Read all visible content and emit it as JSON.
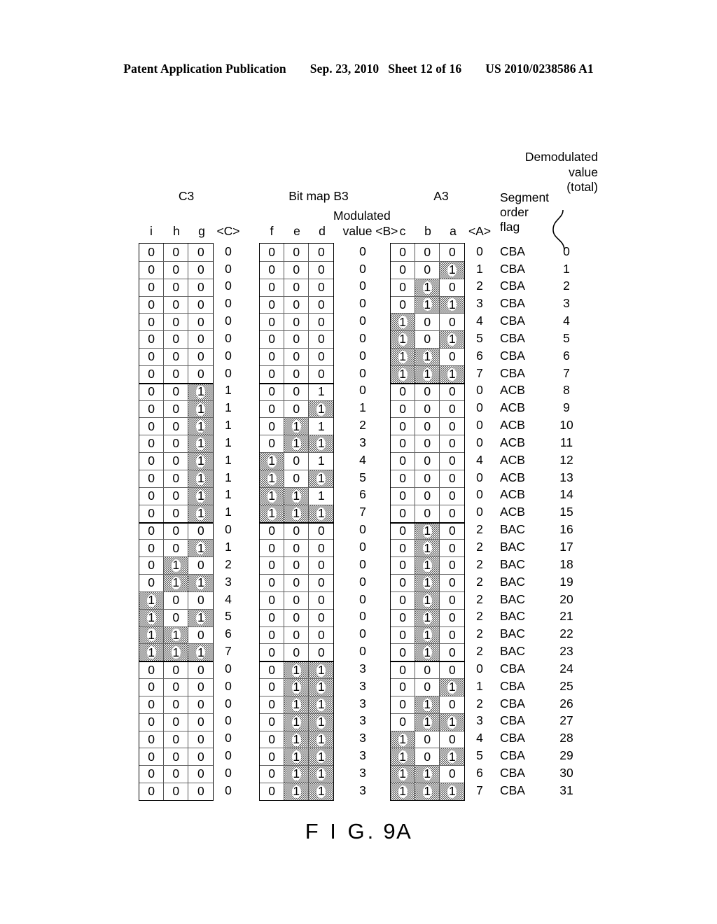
{
  "patent_header": {
    "publication": "Patent Application Publication",
    "date": "Sep. 23, 2010",
    "sheet": "Sheet 12 of 16",
    "number": "US 2010/0238586 A1"
  },
  "figure": {
    "caption_prefix": "F I G.",
    "caption_number": "9A",
    "labels": {
      "c3": "C3",
      "bitmap_b3": "Bit map B3",
      "a3": "A3",
      "modulated_value": "Modulated\nvalue <B>",
      "modulated_line1": "Modulated",
      "segment_order_flag": "Segment\norder\nflag",
      "segment_line1": "Segment",
      "segment_line2": "order",
      "segment_line3": "flag",
      "demodulated_total": "Demodulated\nvalue\n(total)",
      "demod_line1": "Demodulated",
      "demod_line2": "value",
      "demod_line3": "(total)"
    },
    "column_headers": {
      "c3_bits": [
        "i",
        "h",
        "g"
      ],
      "c3_value": "<C>",
      "b3_bits": [
        "f",
        "e",
        "d"
      ],
      "b3_value_label": "value <B>",
      "a3_bits": [
        "c",
        "b",
        "a"
      ],
      "a3_value": "<A>"
    },
    "rows": [
      {
        "c3": [
          0,
          0,
          0
        ],
        "c3_sh": [
          0,
          0,
          0
        ],
        "cval": "0",
        "b3": [
          0,
          0,
          0
        ],
        "b3_sh": [
          0,
          0,
          0
        ],
        "bval": "0",
        "a3": [
          0,
          0,
          0
        ],
        "a3_sh": [
          0,
          0,
          0
        ],
        "aval": "0",
        "flag": "CBA",
        "total": "0"
      },
      {
        "c3": [
          0,
          0,
          0
        ],
        "c3_sh": [
          0,
          0,
          0
        ],
        "cval": "0",
        "b3": [
          0,
          0,
          0
        ],
        "b3_sh": [
          0,
          0,
          0
        ],
        "bval": "0",
        "a3": [
          0,
          0,
          1
        ],
        "a3_sh": [
          0,
          0,
          1
        ],
        "aval": "1",
        "flag": "CBA",
        "total": "1"
      },
      {
        "c3": [
          0,
          0,
          0
        ],
        "c3_sh": [
          0,
          0,
          0
        ],
        "cval": "0",
        "b3": [
          0,
          0,
          0
        ],
        "b3_sh": [
          0,
          0,
          0
        ],
        "bval": "0",
        "a3": [
          0,
          1,
          0
        ],
        "a3_sh": [
          0,
          1,
          0
        ],
        "aval": "2",
        "flag": "CBA",
        "total": "2"
      },
      {
        "c3": [
          0,
          0,
          0
        ],
        "c3_sh": [
          0,
          0,
          0
        ],
        "cval": "0",
        "b3": [
          0,
          0,
          0
        ],
        "b3_sh": [
          0,
          0,
          0
        ],
        "bval": "0",
        "a3": [
          0,
          1,
          1
        ],
        "a3_sh": [
          0,
          1,
          1
        ],
        "aval": "3",
        "flag": "CBA",
        "total": "3"
      },
      {
        "c3": [
          0,
          0,
          0
        ],
        "c3_sh": [
          0,
          0,
          0
        ],
        "cval": "0",
        "b3": [
          0,
          0,
          0
        ],
        "b3_sh": [
          0,
          0,
          0
        ],
        "bval": "0",
        "a3": [
          1,
          0,
          0
        ],
        "a3_sh": [
          1,
          0,
          0
        ],
        "aval": "4",
        "flag": "CBA",
        "total": "4"
      },
      {
        "c3": [
          0,
          0,
          0
        ],
        "c3_sh": [
          0,
          0,
          0
        ],
        "cval": "0",
        "b3": [
          0,
          0,
          0
        ],
        "b3_sh": [
          0,
          0,
          0
        ],
        "bval": "0",
        "a3": [
          1,
          0,
          1
        ],
        "a3_sh": [
          1,
          0,
          1
        ],
        "aval": "5",
        "flag": "CBA",
        "total": "5"
      },
      {
        "c3": [
          0,
          0,
          0
        ],
        "c3_sh": [
          0,
          0,
          0
        ],
        "cval": "0",
        "b3": [
          0,
          0,
          0
        ],
        "b3_sh": [
          0,
          0,
          0
        ],
        "bval": "0",
        "a3": [
          1,
          1,
          0
        ],
        "a3_sh": [
          1,
          1,
          0
        ],
        "aval": "6",
        "flag": "CBA",
        "total": "6"
      },
      {
        "c3": [
          0,
          0,
          0
        ],
        "c3_sh": [
          0,
          0,
          0
        ],
        "cval": "0",
        "b3": [
          0,
          0,
          0
        ],
        "b3_sh": [
          0,
          0,
          0
        ],
        "bval": "0",
        "a3": [
          1,
          1,
          1
        ],
        "a3_sh": [
          1,
          1,
          1
        ],
        "aval": "7",
        "flag": "CBA",
        "total": "7"
      },
      {
        "c3": [
          0,
          0,
          1
        ],
        "c3_sh": [
          0,
          0,
          1
        ],
        "cval": "1",
        "b3": [
          0,
          0,
          1
        ],
        "b3_sh": [
          0,
          0,
          0
        ],
        "bval": "0",
        "a3": [
          0,
          0,
          0
        ],
        "a3_sh": [
          0,
          0,
          0
        ],
        "aval": "0",
        "flag": "ACB",
        "total": "8"
      },
      {
        "c3": [
          0,
          0,
          1
        ],
        "c3_sh": [
          0,
          0,
          1
        ],
        "cval": "1",
        "b3": [
          0,
          0,
          1
        ],
        "b3_sh": [
          0,
          0,
          1
        ],
        "bval": "1",
        "a3": [
          0,
          0,
          0
        ],
        "a3_sh": [
          0,
          0,
          0
        ],
        "aval": "0",
        "flag": "ACB",
        "total": "9"
      },
      {
        "c3": [
          0,
          0,
          1
        ],
        "c3_sh": [
          0,
          0,
          1
        ],
        "cval": "1",
        "b3": [
          0,
          1,
          1
        ],
        "b3_sh": [
          0,
          1,
          0
        ],
        "bval": "2",
        "a3": [
          0,
          0,
          0
        ],
        "a3_sh": [
          0,
          0,
          0
        ],
        "aval": "0",
        "flag": "ACB",
        "total": "10"
      },
      {
        "c3": [
          0,
          0,
          1
        ],
        "c3_sh": [
          0,
          0,
          1
        ],
        "cval": "1",
        "b3": [
          0,
          1,
          1
        ],
        "b3_sh": [
          0,
          1,
          1
        ],
        "bval": "3",
        "a3": [
          0,
          0,
          0
        ],
        "a3_sh": [
          0,
          0,
          0
        ],
        "aval": "0",
        "flag": "ACB",
        "total": "11"
      },
      {
        "c3": [
          0,
          0,
          1
        ],
        "c3_sh": [
          0,
          0,
          1
        ],
        "cval": "1",
        "b3": [
          1,
          0,
          1
        ],
        "b3_sh": [
          1,
          0,
          0
        ],
        "bval": "4",
        "a3": [
          0,
          0,
          0
        ],
        "a3_sh": [
          0,
          0,
          0
        ],
        "aval": "4",
        "flag": "ACB",
        "total": "12"
      },
      {
        "c3": [
          0,
          0,
          1
        ],
        "c3_sh": [
          0,
          0,
          1
        ],
        "cval": "1",
        "b3": [
          1,
          0,
          1
        ],
        "b3_sh": [
          1,
          0,
          1
        ],
        "bval": "5",
        "a3": [
          0,
          0,
          0
        ],
        "a3_sh": [
          0,
          0,
          0
        ],
        "aval": "0",
        "flag": "ACB",
        "total": "13"
      },
      {
        "c3": [
          0,
          0,
          1
        ],
        "c3_sh": [
          0,
          0,
          1
        ],
        "cval": "1",
        "b3": [
          1,
          1,
          1
        ],
        "b3_sh": [
          1,
          1,
          0
        ],
        "bval": "6",
        "a3": [
          0,
          0,
          0
        ],
        "a3_sh": [
          0,
          0,
          0
        ],
        "aval": "0",
        "flag": "ACB",
        "total": "14"
      },
      {
        "c3": [
          0,
          0,
          1
        ],
        "c3_sh": [
          0,
          0,
          1
        ],
        "cval": "1",
        "b3": [
          1,
          1,
          1
        ],
        "b3_sh": [
          1,
          1,
          1
        ],
        "bval": "7",
        "a3": [
          0,
          0,
          0
        ],
        "a3_sh": [
          0,
          0,
          0
        ],
        "aval": "0",
        "flag": "ACB",
        "total": "15"
      },
      {
        "c3": [
          0,
          0,
          0
        ],
        "c3_sh": [
          0,
          0,
          0
        ],
        "cval": "0",
        "b3": [
          0,
          0,
          0
        ],
        "b3_sh": [
          0,
          0,
          0
        ],
        "bval": "0",
        "a3": [
          0,
          1,
          0
        ],
        "a3_sh": [
          0,
          1,
          0
        ],
        "aval": "2",
        "flag": "BAC",
        "total": "16"
      },
      {
        "c3": [
          0,
          0,
          1
        ],
        "c3_sh": [
          0,
          0,
          1
        ],
        "cval": "1",
        "b3": [
          0,
          0,
          0
        ],
        "b3_sh": [
          0,
          0,
          0
        ],
        "bval": "0",
        "a3": [
          0,
          1,
          0
        ],
        "a3_sh": [
          0,
          1,
          0
        ],
        "aval": "2",
        "flag": "BAC",
        "total": "17"
      },
      {
        "c3": [
          0,
          1,
          0
        ],
        "c3_sh": [
          0,
          1,
          0
        ],
        "cval": "2",
        "b3": [
          0,
          0,
          0
        ],
        "b3_sh": [
          0,
          0,
          0
        ],
        "bval": "0",
        "a3": [
          0,
          1,
          0
        ],
        "a3_sh": [
          0,
          1,
          0
        ],
        "aval": "2",
        "flag": "BAC",
        "total": "18"
      },
      {
        "c3": [
          0,
          1,
          1
        ],
        "c3_sh": [
          0,
          1,
          1
        ],
        "cval": "3",
        "b3": [
          0,
          0,
          0
        ],
        "b3_sh": [
          0,
          0,
          0
        ],
        "bval": "0",
        "a3": [
          0,
          1,
          0
        ],
        "a3_sh": [
          0,
          1,
          0
        ],
        "aval": "2",
        "flag": "BAC",
        "total": "19"
      },
      {
        "c3": [
          1,
          0,
          0
        ],
        "c3_sh": [
          1,
          0,
          0
        ],
        "cval": "4",
        "b3": [
          0,
          0,
          0
        ],
        "b3_sh": [
          0,
          0,
          0
        ],
        "bval": "0",
        "a3": [
          0,
          1,
          0
        ],
        "a3_sh": [
          0,
          1,
          0
        ],
        "aval": "2",
        "flag": "BAC",
        "total": "20"
      },
      {
        "c3": [
          1,
          0,
          1
        ],
        "c3_sh": [
          1,
          0,
          1
        ],
        "cval": "5",
        "b3": [
          0,
          0,
          0
        ],
        "b3_sh": [
          0,
          0,
          0
        ],
        "bval": "0",
        "a3": [
          0,
          1,
          0
        ],
        "a3_sh": [
          0,
          1,
          0
        ],
        "aval": "2",
        "flag": "BAC",
        "total": "21"
      },
      {
        "c3": [
          1,
          1,
          0
        ],
        "c3_sh": [
          1,
          1,
          0
        ],
        "cval": "6",
        "b3": [
          0,
          0,
          0
        ],
        "b3_sh": [
          0,
          0,
          0
        ],
        "bval": "0",
        "a3": [
          0,
          1,
          0
        ],
        "a3_sh": [
          0,
          1,
          0
        ],
        "aval": "2",
        "flag": "BAC",
        "total": "22"
      },
      {
        "c3": [
          1,
          1,
          1
        ],
        "c3_sh": [
          1,
          1,
          1
        ],
        "cval": "7",
        "b3": [
          0,
          0,
          0
        ],
        "b3_sh": [
          0,
          0,
          0
        ],
        "bval": "0",
        "a3": [
          0,
          1,
          0
        ],
        "a3_sh": [
          0,
          1,
          0
        ],
        "aval": "2",
        "flag": "BAC",
        "total": "23"
      },
      {
        "c3": [
          0,
          0,
          0
        ],
        "c3_sh": [
          0,
          0,
          0
        ],
        "cval": "0",
        "b3": [
          0,
          1,
          1
        ],
        "b3_sh": [
          0,
          1,
          1
        ],
        "bval": "3",
        "a3": [
          0,
          0,
          0
        ],
        "a3_sh": [
          0,
          0,
          0
        ],
        "aval": "0",
        "flag": "CBA",
        "total": "24"
      },
      {
        "c3": [
          0,
          0,
          0
        ],
        "c3_sh": [
          0,
          0,
          0
        ],
        "cval": "0",
        "b3": [
          0,
          1,
          1
        ],
        "b3_sh": [
          0,
          1,
          1
        ],
        "bval": "3",
        "a3": [
          0,
          0,
          1
        ],
        "a3_sh": [
          0,
          0,
          1
        ],
        "aval": "1",
        "flag": "CBA",
        "total": "25"
      },
      {
        "c3": [
          0,
          0,
          0
        ],
        "c3_sh": [
          0,
          0,
          0
        ],
        "cval": "0",
        "b3": [
          0,
          1,
          1
        ],
        "b3_sh": [
          0,
          1,
          1
        ],
        "bval": "3",
        "a3": [
          0,
          1,
          0
        ],
        "a3_sh": [
          0,
          1,
          0
        ],
        "aval": "2",
        "flag": "CBA",
        "total": "26"
      },
      {
        "c3": [
          0,
          0,
          0
        ],
        "c3_sh": [
          0,
          0,
          0
        ],
        "cval": "0",
        "b3": [
          0,
          1,
          1
        ],
        "b3_sh": [
          0,
          1,
          1
        ],
        "bval": "3",
        "a3": [
          0,
          1,
          1
        ],
        "a3_sh": [
          0,
          1,
          1
        ],
        "aval": "3",
        "flag": "CBA",
        "total": "27"
      },
      {
        "c3": [
          0,
          0,
          0
        ],
        "c3_sh": [
          0,
          0,
          0
        ],
        "cval": "0",
        "b3": [
          0,
          1,
          1
        ],
        "b3_sh": [
          0,
          1,
          1
        ],
        "bval": "3",
        "a3": [
          1,
          0,
          0
        ],
        "a3_sh": [
          1,
          0,
          0
        ],
        "aval": "4",
        "flag": "CBA",
        "total": "28"
      },
      {
        "c3": [
          0,
          0,
          0
        ],
        "c3_sh": [
          0,
          0,
          0
        ],
        "cval": "0",
        "b3": [
          0,
          1,
          1
        ],
        "b3_sh": [
          0,
          1,
          1
        ],
        "bval": "3",
        "a3": [
          1,
          0,
          1
        ],
        "a3_sh": [
          1,
          0,
          1
        ],
        "aval": "5",
        "flag": "CBA",
        "total": "29"
      },
      {
        "c3": [
          0,
          0,
          0
        ],
        "c3_sh": [
          0,
          0,
          0
        ],
        "cval": "0",
        "b3": [
          0,
          1,
          1
        ],
        "b3_sh": [
          0,
          1,
          1
        ],
        "bval": "3",
        "a3": [
          1,
          1,
          0
        ],
        "a3_sh": [
          1,
          1,
          0
        ],
        "aval": "6",
        "flag": "CBA",
        "total": "30"
      },
      {
        "c3": [
          0,
          0,
          0
        ],
        "c3_sh": [
          0,
          0,
          0
        ],
        "cval": "0",
        "b3": [
          0,
          1,
          1
        ],
        "b3_sh": [
          0,
          1,
          1
        ],
        "bval": "3",
        "a3": [
          1,
          1,
          1
        ],
        "a3_sh": [
          1,
          1,
          1
        ],
        "aval": "7",
        "flag": "CBA",
        "total": "31"
      }
    ]
  }
}
